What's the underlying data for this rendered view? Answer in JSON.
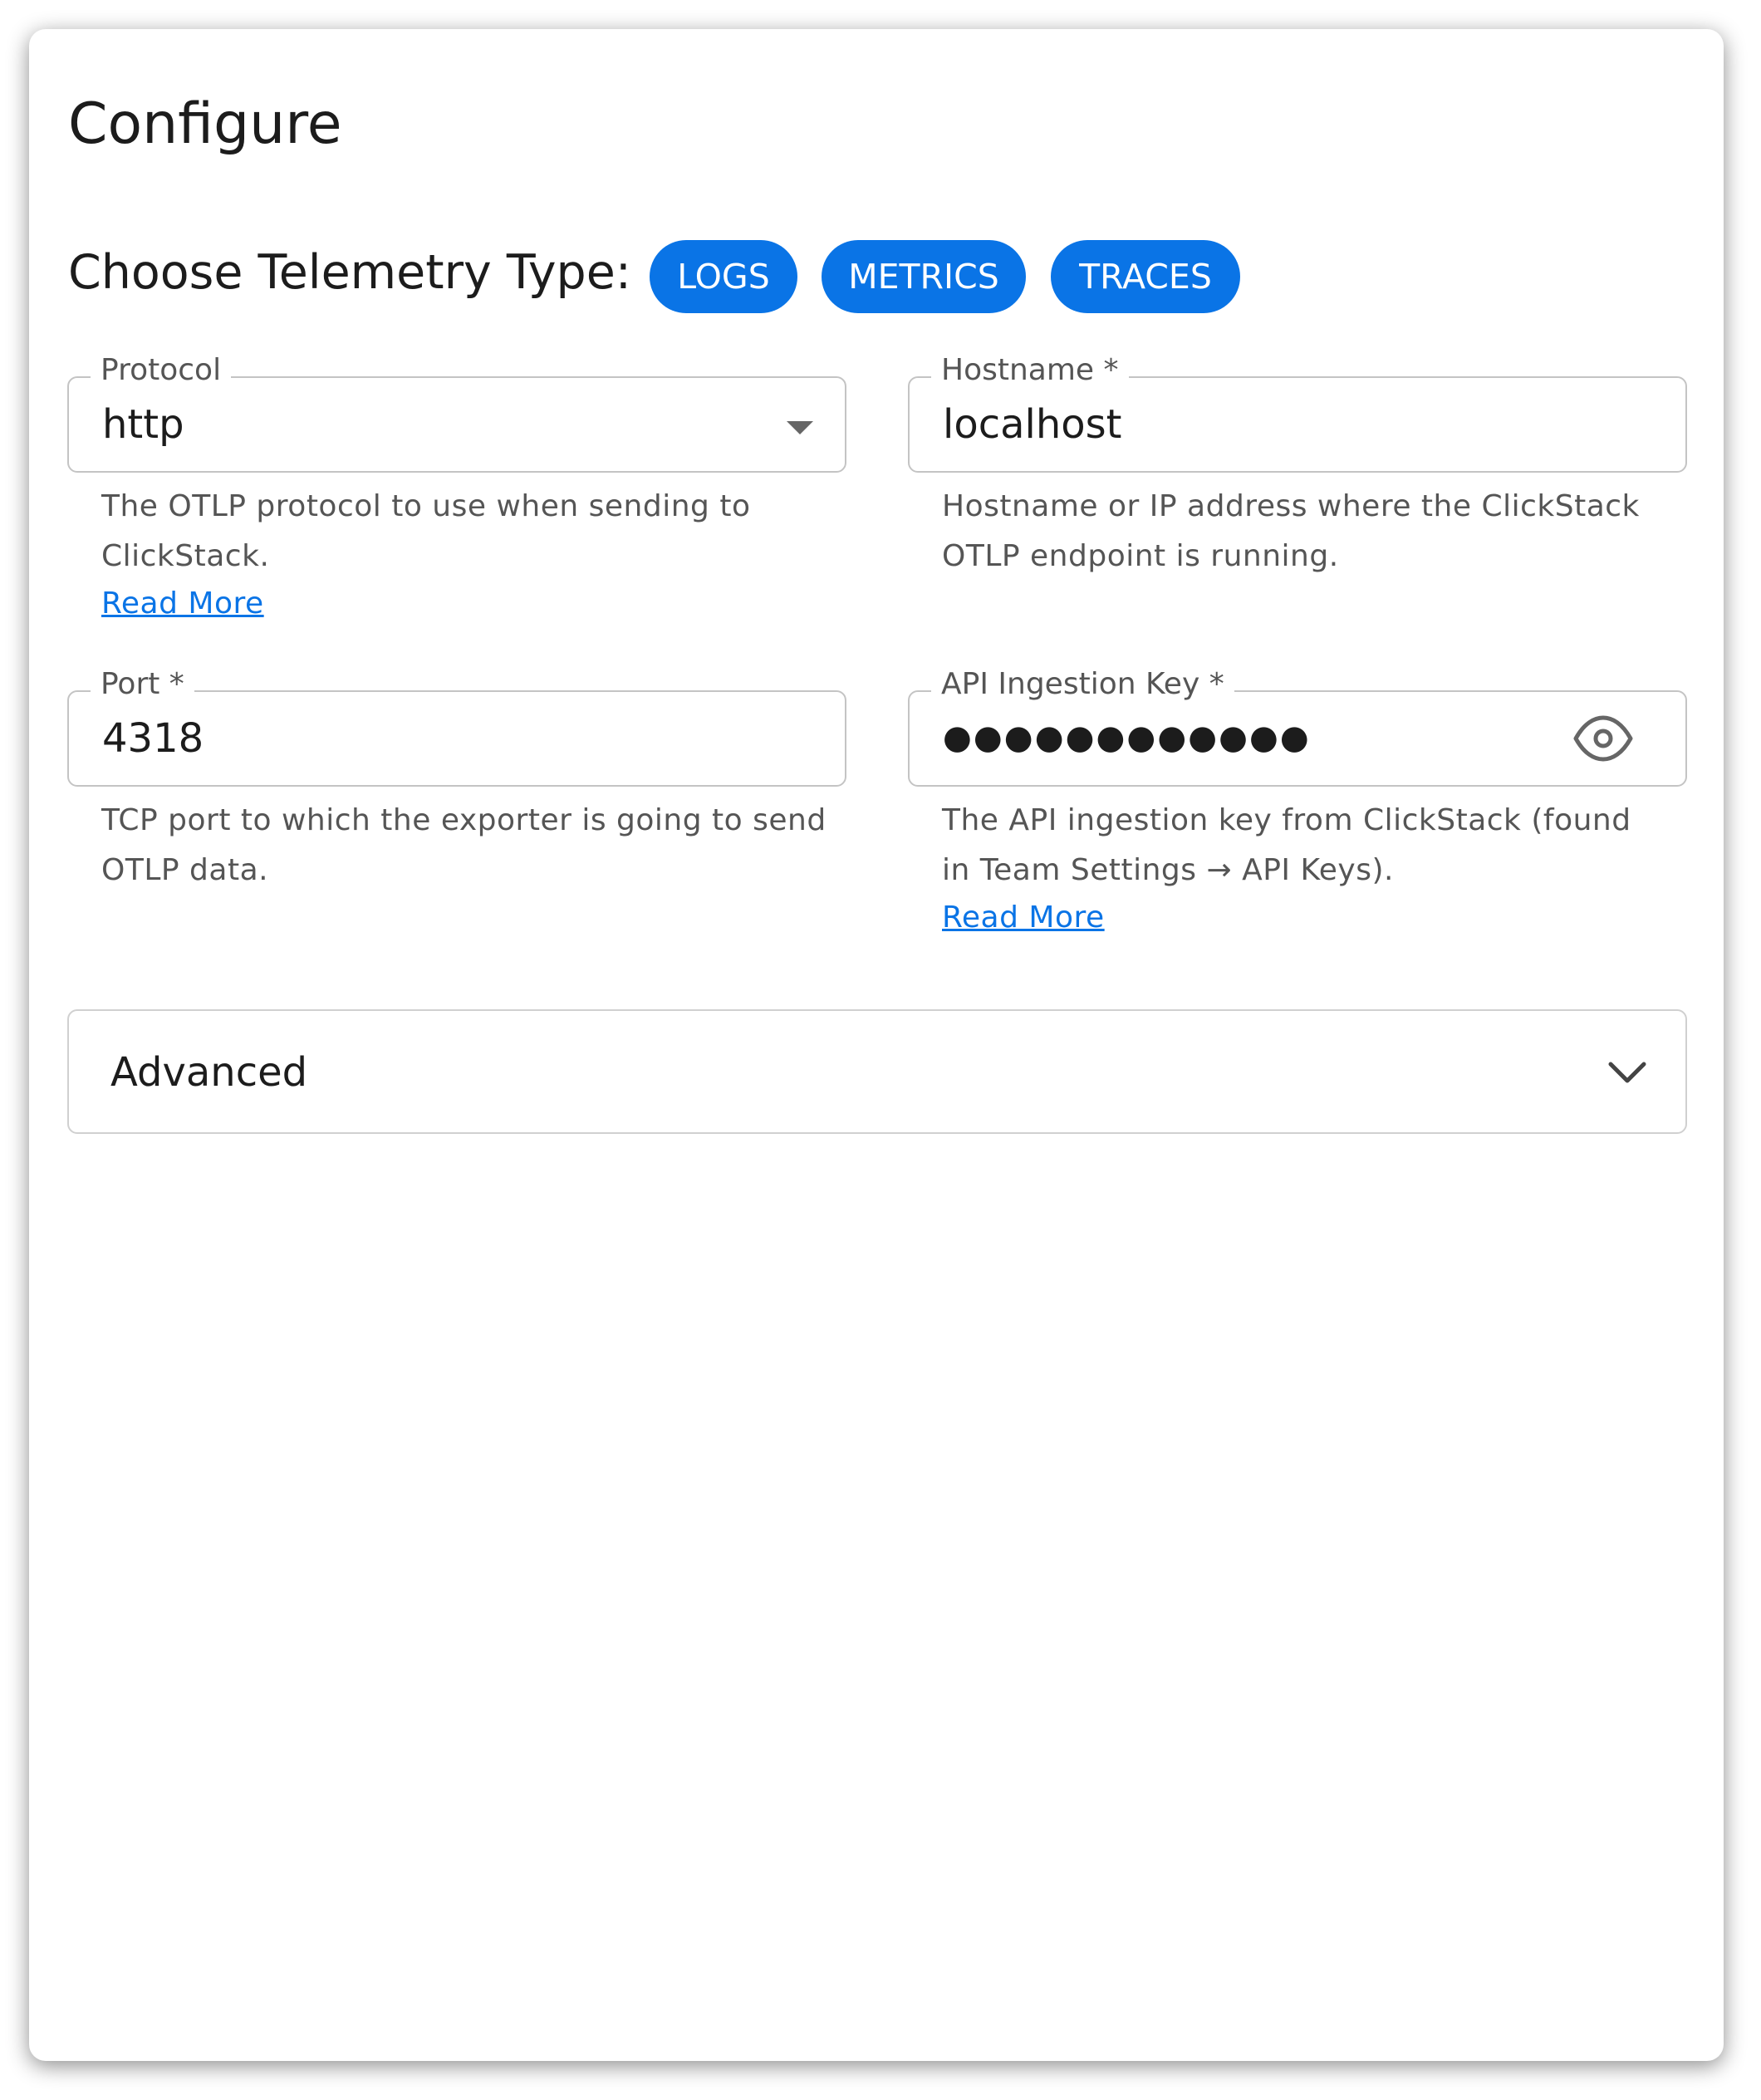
{
  "page": {
    "title": "Configure"
  },
  "telemetry": {
    "label": "Choose Telemetry Type:",
    "options": [
      "LOGS",
      "METRICS",
      "TRACES"
    ],
    "accent_color": "#0a74e6"
  },
  "protocol": {
    "label": "Protocol",
    "value": "http",
    "helper": "The OTLP protocol to use when sending to ClickStack.",
    "link": "Read More"
  },
  "hostname": {
    "label": "Hostname *",
    "value": "localhost",
    "helper": "Hostname or IP address where the ClickStack OTLP endpoint is running."
  },
  "port": {
    "label": "Port *",
    "value": "4318",
    "helper": "TCP port to which the exporter is going to send OTLP data."
  },
  "api_key": {
    "label": "API Ingestion Key *",
    "value": "●●●●●●●●●●●●",
    "helper": "The API ingestion key from ClickStack (found in Team Settings → API Keys).",
    "link": "Read More",
    "icon": "eye-icon"
  },
  "advanced": {
    "label": "Advanced",
    "icon": "chevron-down-icon"
  }
}
